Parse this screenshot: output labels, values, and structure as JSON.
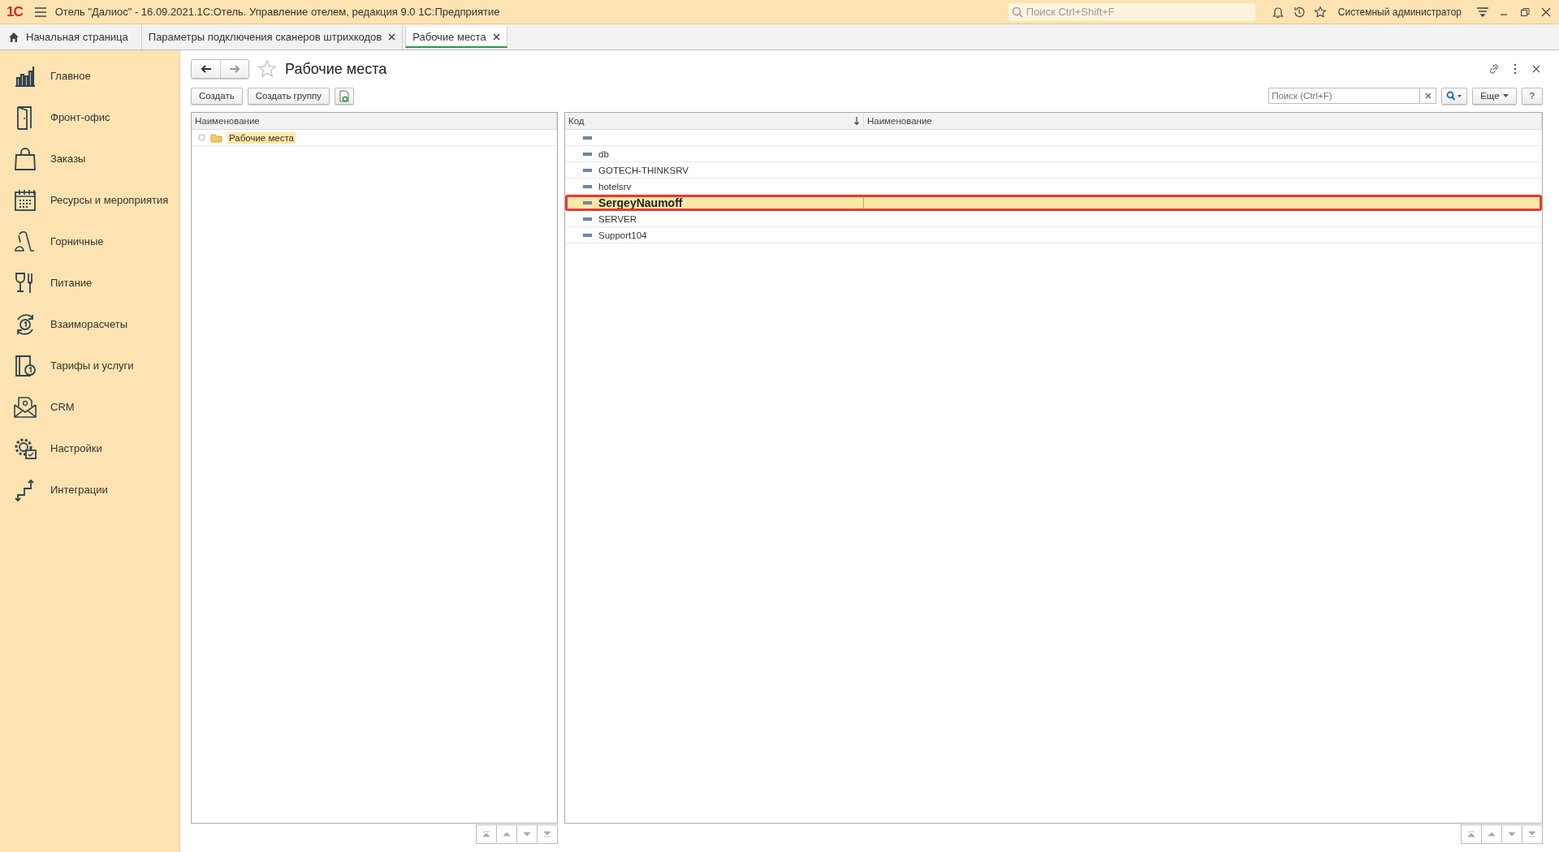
{
  "window": {
    "logo": "1С",
    "title": "Отель \"Далиос\" - 16.09.2021.1С:Отель. Управление отелем, редакция 9.0 1С:Предприятие",
    "search_placeholder": "Поиск Ctrl+Shift+F",
    "user": "Системный администратор"
  },
  "tabs": [
    {
      "label": "Начальная страница",
      "kind": "home",
      "selected": false
    },
    {
      "label": "Параметры подключения сканеров штрихкодов",
      "kind": "closable",
      "selected": false
    },
    {
      "label": "Рабочие места",
      "kind": "closable",
      "selected": true
    }
  ],
  "sidebar": {
    "items": [
      {
        "label": "Главное",
        "kind": "chart"
      },
      {
        "label": "Фронт-офис",
        "kind": "door"
      },
      {
        "label": "Заказы",
        "kind": "bag"
      },
      {
        "label": "Ресурсы и мероприятия",
        "kind": "calendar"
      },
      {
        "label": "Горничные",
        "kind": "vacuum"
      },
      {
        "label": "Питание",
        "kind": "food"
      },
      {
        "label": "Взаиморасчеты",
        "kind": "cycle"
      },
      {
        "label": "Тарифы и услуги",
        "kind": "book"
      },
      {
        "label": "CRM",
        "kind": "mail"
      },
      {
        "label": "Настройки",
        "kind": "gear"
      },
      {
        "label": "Интеграции",
        "kind": "arrows"
      }
    ]
  },
  "form": {
    "title": "Рабочие места",
    "toolbar": [
      "Создать",
      "Создать группу"
    ],
    "search": {
      "placeholder": "Поиск (Ctrl+F)"
    },
    "more_button": "Еще",
    "help_button": "?"
  },
  "tree": {
    "column": "Наименование",
    "items": [
      {
        "label": "Рабочие места",
        "selected": true
      }
    ]
  },
  "list": {
    "columns": [
      {
        "label": "Код",
        "sorted": true
      },
      {
        "label": "Наименование",
        "sorted": false
      }
    ],
    "rows": [
      {
        "selected": false
      },
      {
        "code": "db",
        "selected": false
      },
      {
        "code": "GOTECH-THINKSRV",
        "selected": false
      },
      {
        "code": "hotelsrv",
        "selected": false
      },
      {
        "code": "SergeyNaumoff",
        "selected": true
      },
      {
        "code": "SERVER",
        "selected": false
      },
      {
        "code": "Support104",
        "selected": false
      }
    ]
  }
}
